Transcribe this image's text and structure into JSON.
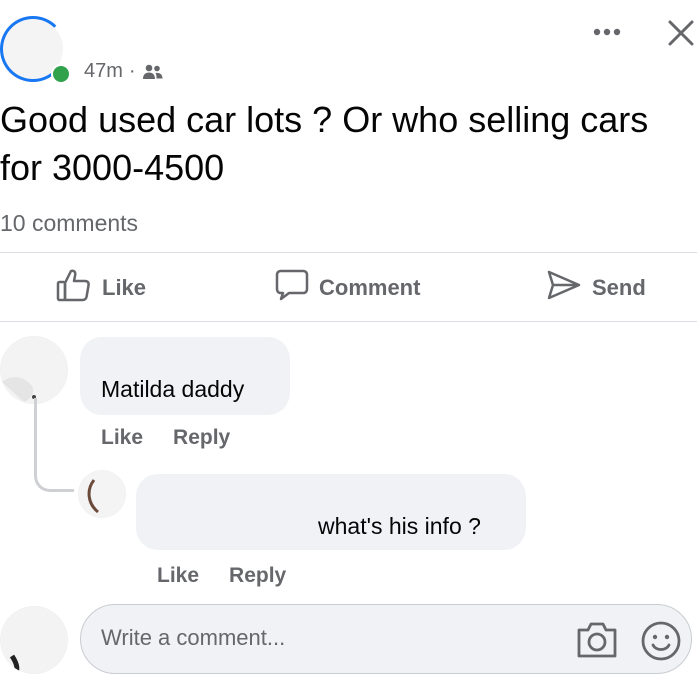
{
  "post": {
    "time": "47m",
    "separator": "·",
    "audience_icon": "friends-icon",
    "text_line1": "Good used car lots ? Or who selling cars",
    "text_line2": "for 3000-4500",
    "comments_count": "10 comments"
  },
  "header": {
    "more_icon": "more-options-icon",
    "close_icon": "close-icon"
  },
  "actions": {
    "like": "Like",
    "comment": "Comment",
    "send": "Send"
  },
  "comments": [
    {
      "text": "Matilda daddy",
      "like_label": "Like",
      "reply_label": "Reply"
    },
    {
      "text": "what's his info ?",
      "like_label": "Like",
      "reply_label": "Reply"
    }
  ],
  "composer": {
    "placeholder": "Write a comment...",
    "camera_icon": "camera-icon",
    "emoji_icon": "emoji-icon"
  },
  "colors": {
    "accent": "#1877f2",
    "online": "#31a24c",
    "secondary_text": "#65676b",
    "bubble": "#f0f2f5"
  }
}
